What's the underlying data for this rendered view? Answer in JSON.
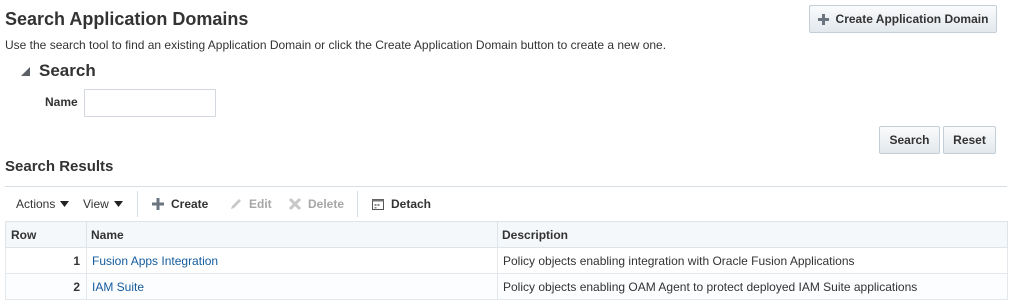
{
  "header": {
    "title": "Search Application Domains",
    "description": "Use the search tool to find an existing Application Domain or click the Create Application Domain button to create a new one.",
    "create_button_label": "Create Application Domain"
  },
  "search": {
    "title": "Search",
    "name_label": "Name",
    "name_value": "",
    "search_button": "Search",
    "reset_button": "Reset"
  },
  "results": {
    "title": "Search Results",
    "toolbar": {
      "actions": "Actions",
      "view": "View",
      "create": "Create",
      "edit": "Edit",
      "delete": "Delete",
      "detach": "Detach"
    },
    "columns": [
      "Row",
      "Name",
      "Description"
    ],
    "rows": [
      {
        "row": "1",
        "name": "Fusion Apps Integration",
        "description": "Policy objects enabling integration with Oracle Fusion Applications"
      },
      {
        "row": "2",
        "name": "IAM Suite",
        "description": "Policy objects enabling OAM Agent to protect deployed IAM Suite applications"
      }
    ]
  },
  "colors": {
    "link": "#145c9e",
    "text": "#333333",
    "border": "#d6dfe6"
  },
  "icons": [
    "plus-icon",
    "disclose-triangle-icon",
    "dropdown-triangle-icon",
    "pencil-icon",
    "delete-x-icon",
    "detach-icon"
  ]
}
